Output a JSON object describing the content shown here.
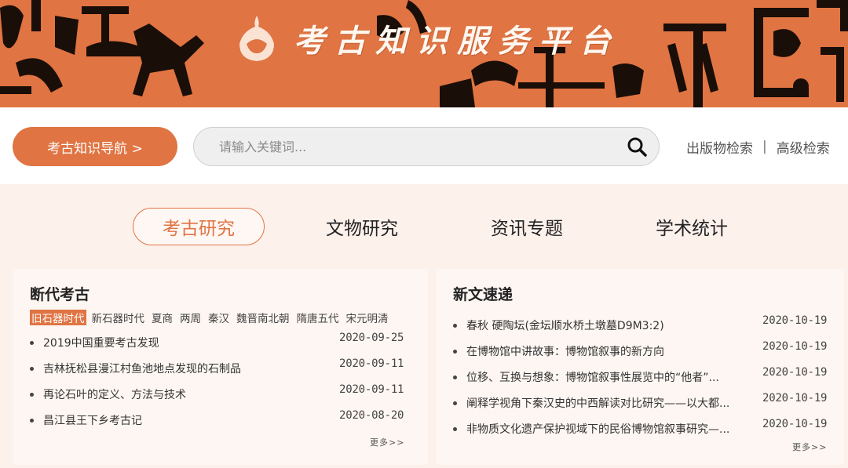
{
  "banner": {
    "title": "考古知识服务平台",
    "colors": {
      "background": "#e07443",
      "glyphs": "#1a0e08"
    }
  },
  "searchbar": {
    "nav_button": "考古知识导航 >",
    "placeholder": "请输入关键词...",
    "links": [
      "出版物检索",
      "高级检索"
    ],
    "separator": "|"
  },
  "tabs": [
    {
      "label": "考古研究",
      "active": true
    },
    {
      "label": "文物研究",
      "active": false
    },
    {
      "label": "资讯专题",
      "active": false
    },
    {
      "label": "学术统计",
      "active": false
    }
  ],
  "left_panel": {
    "title": "断代考古",
    "eras": [
      "旧石器时代",
      "新石器时代",
      "夏商",
      "两周",
      "秦汉",
      "魏晋南北朝",
      "隋唐五代",
      "宋元明清"
    ],
    "active_era": 0,
    "items": [
      {
        "title": "2019中国重要考古发现",
        "date": "2020-09-25"
      },
      {
        "title": "吉林抚松县漫江村鱼池地点发现的石制品",
        "date": "2020-09-11"
      },
      {
        "title": "再论石叶的定义、方法与技术",
        "date": "2020-09-11"
      },
      {
        "title": "昌江县王下乡考古记",
        "date": "2020-08-20"
      }
    ],
    "more": "更多>>"
  },
  "right_panel": {
    "title": "新文速递",
    "items": [
      {
        "title": "春秋 硬陶坛(金坛顺水桥土墩墓D9M3:2)",
        "date": "2020-10-19"
      },
      {
        "title": "在博物馆中讲故事：博物馆叙事的新方向",
        "date": "2020-10-19"
      },
      {
        "title": "位移、互换与想象：博物馆叙事性展览中的“他者”...",
        "date": "2020-10-19"
      },
      {
        "title": "阐释学视角下秦汉史的中西解读对比研究——以大都...",
        "date": "2020-10-19"
      },
      {
        "title": "非物质文化遗产保护视域下的民俗博物馆叙事研究—...",
        "date": "2020-10-19"
      }
    ],
    "more": "更多>>"
  }
}
